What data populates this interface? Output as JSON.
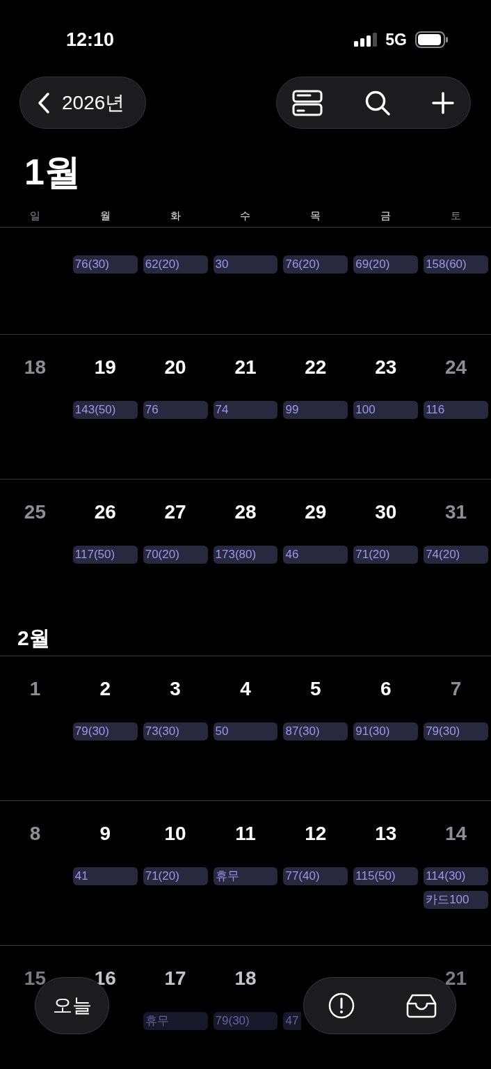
{
  "status_bar": {
    "time": "12:10",
    "network": "5G"
  },
  "header": {
    "back_label": "2026년"
  },
  "days_of_week": [
    {
      "label": "일",
      "weekend": true
    },
    {
      "label": "월",
      "weekend": false
    },
    {
      "label": "화",
      "weekend": false
    },
    {
      "label": "수",
      "weekend": false
    },
    {
      "label": "목",
      "weekend": false
    },
    {
      "label": "금",
      "weekend": false
    },
    {
      "label": "토",
      "weekend": true
    }
  ],
  "months": [
    {
      "title": "1월",
      "weeks": [
        {
          "faded": false,
          "days": [
            {
              "after_hidden_day": true,
              "events": [
                "76(30)"
              ]
            },
            {
              "events": [
                "62(20)"
              ]
            },
            {
              "events": [
                "30"
              ]
            },
            {
              "events": [
                "76(20)"
              ]
            },
            {
              "events": [
                "69(20)"
              ]
            },
            {
              "events": [
                "158(60)"
              ]
            }
          ]
        },
        {
          "faded": false,
          "days": [
            {
              "number": "18"
            },
            {
              "number": "19",
              "events": [
                "143(50)"
              ]
            },
            {
              "number": "20",
              "events": [
                "76"
              ]
            },
            {
              "number": "21",
              "events": [
                "74"
              ]
            },
            {
              "number": "22",
              "events": [
                "99"
              ]
            },
            {
              "number": "23",
              "events": [
                "100"
              ]
            },
            {
              "number": "24",
              "events": [
                "116"
              ]
            }
          ]
        },
        {
          "faded": false,
          "days": [
            {
              "number": "25"
            },
            {
              "number": "26",
              "events": [
                "117(50)"
              ]
            },
            {
              "number": "27",
              "events": [
                "70(20)"
              ]
            },
            {
              "number": "28",
              "events": [
                "173(80)"
              ]
            },
            {
              "number": "29",
              "events": [
                "46"
              ]
            },
            {
              "number": "30",
              "events": [
                "71(20)"
              ]
            },
            {
              "number": "31",
              "events": [
                "74(20)"
              ]
            }
          ]
        }
      ]
    },
    {
      "title": "2월",
      "weeks": [
        {
          "faded": false,
          "days": [
            {
              "number": "1"
            },
            {
              "number": "2",
              "events": [
                "79(30)"
              ]
            },
            {
              "number": "3",
              "events": [
                "73(30)"
              ]
            },
            {
              "number": "4",
              "events": [
                "50"
              ]
            },
            {
              "number": "5",
              "events": [
                "87(30)"
              ]
            },
            {
              "number": "6",
              "events": [
                "91(30)"
              ]
            },
            {
              "number": "7",
              "events": [
                "79(30)"
              ]
            }
          ]
        },
        {
          "faded": false,
          "days": [
            {
              "number": "8"
            },
            {
              "number": "9",
              "events": [
                "41"
              ]
            },
            {
              "number": "10",
              "events": [
                "71(20)"
              ]
            },
            {
              "number": "11",
              "events": [
                "휴무"
              ]
            },
            {
              "number": "12",
              "events": [
                "77(40)"
              ]
            },
            {
              "number": "13",
              "events": [
                "115(50)"
              ]
            },
            {
              "number": "14",
              "events": [
                "114(30)",
                "카드100"
              ]
            }
          ]
        },
        {
          "faded": true,
          "days": [
            {
              "number": "15"
            },
            {
              "number": "16"
            },
            {
              "number": "17",
              "events": [
                "휴무"
              ]
            },
            {
              "number": "18",
              "events": [
                "79(30)"
              ]
            },
            {
              "clipped": true,
              "events": [
                "47"
              ]
            },
            {
              "after_hidden_day": true,
              "number": "21"
            }
          ]
        }
      ]
    }
  ],
  "floating": {
    "today_label": "오늘"
  }
}
